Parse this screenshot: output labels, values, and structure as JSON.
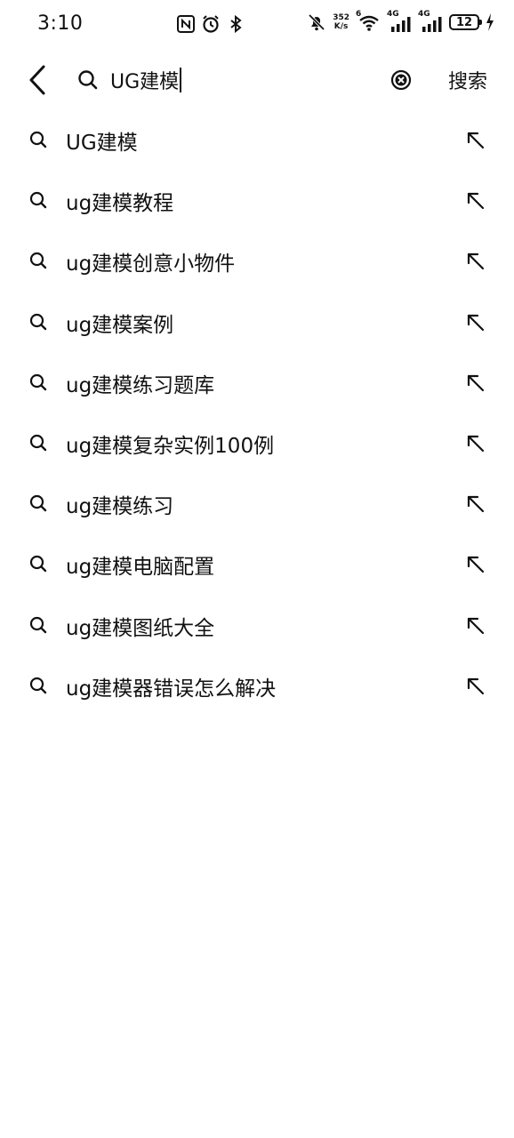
{
  "status_bar": {
    "time": "3:10",
    "net_speed_value": "352",
    "net_speed_unit": "K/s",
    "wifi_gen": "6",
    "sim1_type": "4G",
    "sim2_type": "4G",
    "battery_level": "12",
    "icons": [
      "nfc-icon",
      "alarm-icon",
      "bluetooth-icon",
      "mute-bell-icon",
      "wifi-icon",
      "signal-icon",
      "signal-icon",
      "battery-icon",
      "charging-icon"
    ]
  },
  "search": {
    "value": "UG建模",
    "submit_label": "搜索",
    "icons": [
      "back-arrow-icon",
      "search-icon",
      "clear-icon"
    ]
  },
  "suggestions": [
    {
      "label": "UG建模"
    },
    {
      "label": "ug建模教程"
    },
    {
      "label": "ug建模创意小物件"
    },
    {
      "label": "ug建模案例"
    },
    {
      "label": "ug建模练习题库"
    },
    {
      "label": "ug建模复杂实例100例"
    },
    {
      "label": "ug建模练习"
    },
    {
      "label": "ug建模电脑配置"
    },
    {
      "label": "ug建模图纸大全"
    },
    {
      "label": "ug建模器错误怎么解决"
    }
  ],
  "colors": {
    "background": "#ffffff",
    "text": "#111111"
  }
}
